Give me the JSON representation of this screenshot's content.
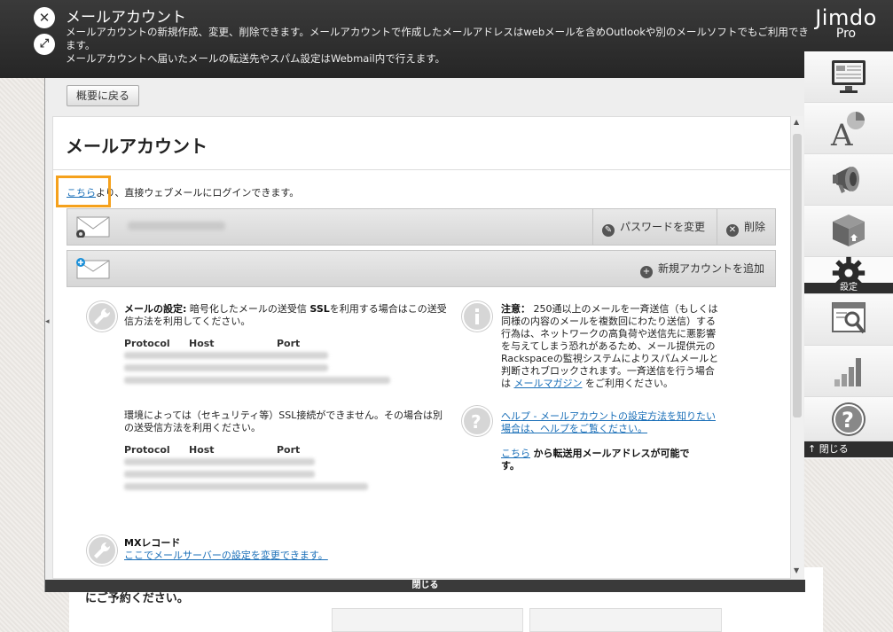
{
  "header": {
    "title": "メールアカウント",
    "description_line1": "メールアカウントの新規作成、変更、削除できます。メールアカウントで作成したメールアドレスはwebメールを含めOutlookや別のメールソフトでもご利用できます。",
    "description_line2": "メールアカウントへ届いたメールの転送先やスパム設定はWebmail内で行えます。",
    "close_icon": "close-icon",
    "expand_icon": "expand-icon"
  },
  "logo": {
    "main": "Jimdo",
    "sub": "Pro"
  },
  "sidebar": {
    "items": [
      {
        "name": "layout-icon",
        "label": ""
      },
      {
        "name": "style-icon",
        "label": ""
      },
      {
        "name": "megaphone-icon",
        "label": ""
      },
      {
        "name": "package-icon",
        "label": ""
      },
      {
        "name": "gear-icon",
        "label": "設定"
      },
      {
        "name": "seo-icon",
        "label": ""
      },
      {
        "name": "stats-icon",
        "label": ""
      },
      {
        "name": "help-icon",
        "label": ""
      }
    ],
    "close_label": "閉じる"
  },
  "panel": {
    "back_label": "概要に戻る",
    "footer_close": "閉じる"
  },
  "content": {
    "heading": "メールアカウント",
    "login_link": "こちら",
    "login_text": "より、直接ウェブメールにログインできます。",
    "account_actions": {
      "change_password": "パスワードを変更",
      "delete": "削除"
    },
    "add_account": "新規アカウントを追加",
    "mail_settings": {
      "label": "メールの設定:",
      "text1": "暗号化したメールの送受信",
      "ssl": "SSL",
      "text2": "を利用する場合はこの送受",
      "text3": "信方法を利用してください。",
      "proto_headers": [
        "Protocol",
        "Host",
        "Port"
      ],
      "fallback_text1": "環境によっては（セキュリティ等）SSL接続ができません。その場合は別",
      "fallback_text2": "の送受信方法を利用ください。"
    },
    "mx": {
      "label": "MXレコード",
      "link": "ここでメールサーバーの設定を変更できます。"
    },
    "notice": {
      "label": "注意：",
      "line1": "250通以上のメールを一斉送信（もしくは",
      "line2": "同様の内容のメールを複数回にわたり送信）する",
      "line3": "行為は、ネットワークの高負荷や送信先に悪影響",
      "line4": "を与えてしまう恐れがあるため、メール提供元の",
      "line5": "Rackspaceの監視システムによりスパムメールと",
      "line6": "判断されブロックされます。一斉送信を行う場合",
      "line7_prefix": "は",
      "line7_link": "メールマガジン",
      "line7_suffix": "をご利用ください。"
    },
    "help": {
      "link_line1": "ヘルプ - メールアカウントの設定方法を知りたい",
      "link_line2": "場合は、ヘルプをご覧ください。"
    },
    "forward": {
      "link": "こちら",
      "text1": "から転送用メールアドレスが可能で",
      "text2": "す。"
    }
  },
  "background": {
    "text": "にご予約ください。"
  }
}
